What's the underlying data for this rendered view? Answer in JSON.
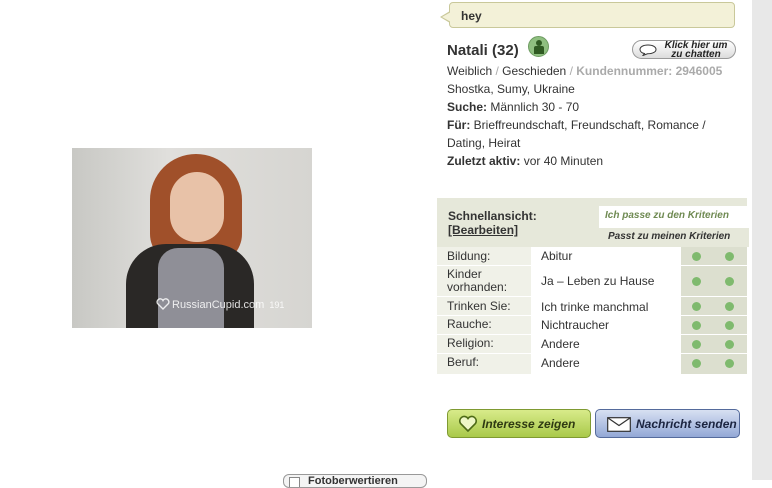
{
  "message": {
    "text": "hey"
  },
  "profile": {
    "name": "Natali (32)",
    "chat_button": "Klick hier um zu chatten",
    "gender": "Weiblich",
    "status": "Geschieden",
    "customer_number": "Kundennummer: 2946005",
    "location": "Shostka, Sumy, Ukraine",
    "search_label": "Suche:",
    "search_value": "Männlich 30 - 70",
    "for_label": "Für:",
    "for_value_line1": "Brieffreundschaft, Freundschaft, Romance /",
    "for_value_line2": "Dating, Heirat",
    "last_active_label": "Zuletzt aktiv:",
    "last_active_value": "vor 40 Minuten"
  },
  "photo": {
    "watermark": "RussianCupid.com",
    "number": "191"
  },
  "quickview": {
    "title": "Schnellansicht:",
    "edit_link": "[Bearbeiten]",
    "tab1": "Ich passe zu den Kriterien",
    "tab2": "Passt zu meinen Kriterien",
    "rows": [
      {
        "key": "Bildung:",
        "value": "Abitur"
      },
      {
        "key_line1": "Kinder",
        "key_line2": "vorhanden:",
        "value": "Ja – Leben zu Hause"
      },
      {
        "key": "Trinken Sie:",
        "value": "Ich trinke manchmal"
      },
      {
        "key": "Rauche:",
        "value": "Nichtraucher"
      },
      {
        "key": "Religion:",
        "value": "Andere"
      },
      {
        "key": "Beruf:",
        "value": "Andere"
      }
    ]
  },
  "actions": {
    "interest": "Interesse zeigen",
    "message": "Nachricht senden"
  },
  "photo_options": {
    "label": "Fotoberwertieren"
  },
  "colors": {
    "match_dot": "#7fba6e",
    "interest_button": "#a9c94a",
    "message_button": "#93a8d6",
    "panel_bg": "#e6e8da"
  },
  "icons": [
    "online-status-icon",
    "chat-bubble-icon",
    "heart-icon",
    "envelope-icon"
  ]
}
